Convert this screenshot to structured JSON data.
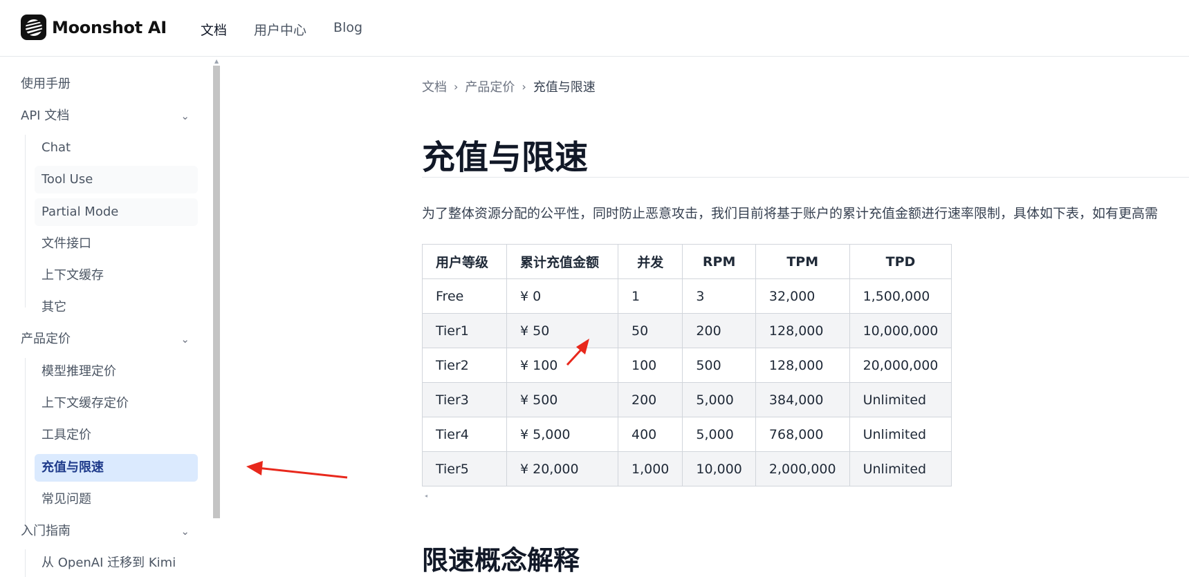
{
  "header": {
    "brand": "Moonshot AI",
    "nav": [
      {
        "label": "文档",
        "active": true
      },
      {
        "label": "用户中心",
        "active": false
      },
      {
        "label": "Blog",
        "active": false
      }
    ]
  },
  "sidebar": {
    "manual": "使用手册",
    "api_docs": {
      "label": "API 文档",
      "items": [
        "Chat",
        "Tool Use",
        "Partial Mode",
        "文件接口",
        "上下文缓存",
        "其它"
      ]
    },
    "pricing": {
      "label": "产品定价",
      "items": [
        "模型推理定价",
        "上下文缓存定价",
        "工具定价",
        "充值与限速",
        "常见问题"
      ],
      "active": "充值与限速"
    },
    "getting_started": {
      "label": "入门指南",
      "items": [
        "从 OpenAI 迁移到 Kimi"
      ]
    }
  },
  "breadcrumb": [
    "文档",
    "产品定价",
    "充值与限速"
  ],
  "page": {
    "title": "充值与限速",
    "intro": "为了整体资源分配的公平性，同时防止恶意攻击，我们目前将基于账户的累计充值金额进行速率限制，具体如下表，如有更高需",
    "section2_title": "限速概念解释"
  },
  "table": {
    "headers": [
      "用户等级",
      "累计充值金额",
      "并发",
      "RPM",
      "TPM",
      "TPD"
    ],
    "rows": [
      [
        "Free",
        "¥ 0",
        "1",
        "3",
        "32,000",
        "1,500,000"
      ],
      [
        "Tier1",
        "¥ 50",
        "50",
        "200",
        "128,000",
        "10,000,000"
      ],
      [
        "Tier2",
        "¥ 100",
        "100",
        "500",
        "128,000",
        "20,000,000"
      ],
      [
        "Tier3",
        "¥ 500",
        "200",
        "5,000",
        "384,000",
        "Unlimited"
      ],
      [
        "Tier4",
        "¥ 5,000",
        "400",
        "5,000",
        "768,000",
        "Unlimited"
      ],
      [
        "Tier5",
        "¥ 20,000",
        "1,000",
        "10,000",
        "2,000,000",
        "Unlimited"
      ]
    ]
  },
  "icons": {
    "chevron": "chevron-down-icon",
    "breadcrumb_sep": "chevron-right-icon"
  },
  "colors": {
    "active_bg": "#dbeafe",
    "active_text": "#1e3a8a",
    "annotation_arrow": "#e8281c"
  }
}
